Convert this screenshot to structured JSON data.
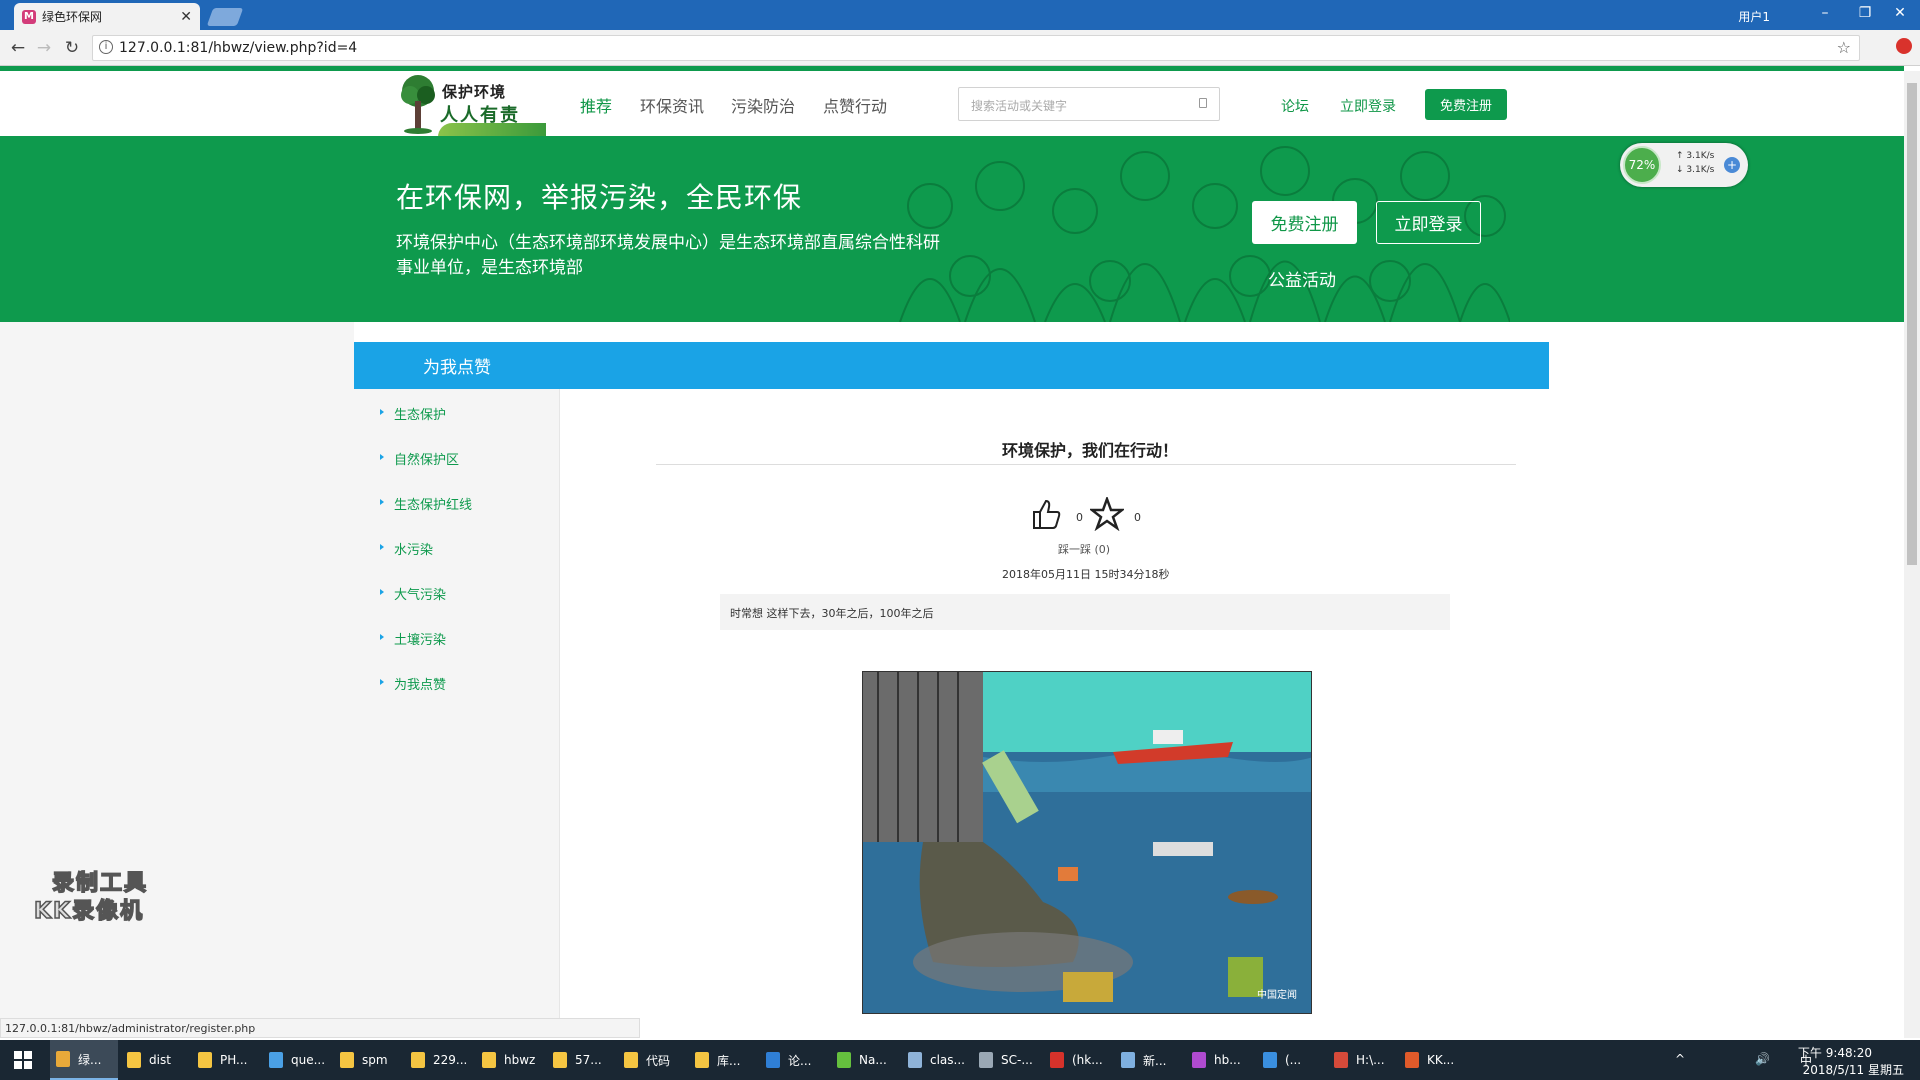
{
  "browser": {
    "tab_title": "绿色环保网",
    "tab_icon_letter": "M",
    "user_label": "用户1",
    "url": "127.0.0.1:81/hbwz/view.php?id=4",
    "status_url": "127.0.0.1:81/hbwz/administrator/register.php"
  },
  "site_nav": {
    "logo_line1": "保护环境",
    "logo_line2": "人人有责",
    "items": [
      "推荐",
      "环保资讯",
      "污染防治",
      "点赞行动"
    ],
    "search_placeholder": "搜索活动或关键字",
    "forum": "论坛",
    "login": "立即登录",
    "register": "免费注册"
  },
  "banner": {
    "headline": "在环保网，举报污染，全民环保",
    "description": "环境保护中心（生态环境部环境发展中心）是生态环境部直属综合性科研事业单位，是生态环境部",
    "register_button": "免费注册",
    "login_button": "立即登录",
    "public_link": "公益活动"
  },
  "net_widget": {
    "percent": "72%",
    "up_speed": "3.1K/s",
    "down_speed": "3.1K/s"
  },
  "sidebar": {
    "header": "为我点赞",
    "items": [
      "生态保护",
      "自然保护区",
      "生态保护红线",
      "水污染",
      "大气污染",
      "土壤污染",
      "为我点赞"
    ]
  },
  "article": {
    "title": "环境保护，我们在行动！",
    "likes": "0",
    "favorites": "0",
    "dislike": "踩一踩 (0)",
    "date": "2018年05月11日 15时34分18秒",
    "summary": "时常想 这样下去，30年之后，100年之后",
    "image_watermark": "中国定闻",
    "image_alt": "pollution-cartoon"
  },
  "recorder_watermark": {
    "line1": "录制工具",
    "line2": "KK录像机"
  },
  "taskbar": {
    "items": [
      "绿...",
      "dist",
      "PH...",
      "que...",
      "spm",
      "229...",
      "hbwz",
      "57...",
      "代码",
      "库...",
      "论...",
      "Na...",
      "clas...",
      "SC-...",
      "(hk...",
      "新...",
      "hb...",
      "(...",
      "H:\\...",
      "KK..."
    ],
    "item_colors": [
      "#e8a93a",
      "#f5c542",
      "#f5c542",
      "#4aa0e6",
      "#f5c542",
      "#f5c542",
      "#f5c542",
      "#f5c542",
      "#f5c542",
      "#f5c542",
      "#2f7fd6",
      "#65c03e",
      "#8fb3d9",
      "#9aa8b5",
      "#d6322b",
      "#7fb0e0",
      "#b04bd0",
      "#3a8fe0",
      "#d64a3a",
      "#e05a2a"
    ],
    "time": "下午 9:48:20",
    "date": "2018/5/11 星期五",
    "ime": "中"
  },
  "colors": {
    "brand_green": "#0e9a4d",
    "accent_blue": "#1aa3e6"
  }
}
